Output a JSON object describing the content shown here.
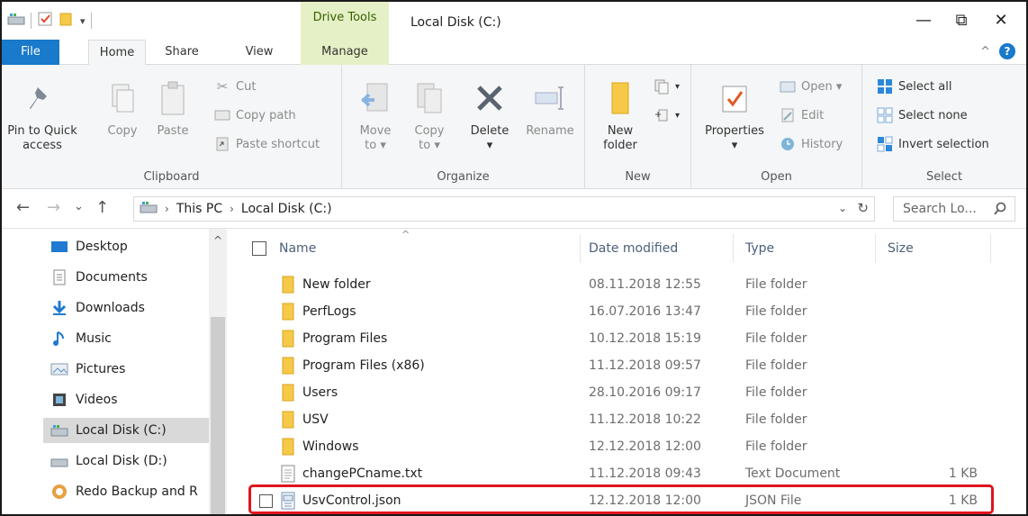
{
  "window": {
    "title": "Local Disk (C:)",
    "context_tab_header": "Drive Tools",
    "minimize": "—",
    "restore": "⧉",
    "close": "✕"
  },
  "tabs": {
    "file": "File",
    "home": "Home",
    "share": "Share",
    "view": "View",
    "manage": "Manage",
    "collapse_glyph": "^",
    "help_glyph": "?"
  },
  "ribbon": {
    "clipboard": {
      "label": "Clipboard",
      "pin_line1": "Pin to Quick",
      "pin_line2": "access",
      "copy": "Copy",
      "paste": "Paste",
      "cut": "Cut",
      "copy_path": "Copy path",
      "paste_shortcut": "Paste shortcut"
    },
    "organize": {
      "label": "Organize",
      "move_line1": "Move",
      "move_line2": "to ▾",
      "copy_line1": "Copy",
      "copy_line2": "to ▾",
      "delete_line1": "Delete",
      "delete_line2": "▾",
      "rename": "Rename"
    },
    "new": {
      "label": "New",
      "folder_line1": "New",
      "folder_line2": "folder"
    },
    "open": {
      "label": "Open",
      "properties_line1": "Properties",
      "properties_line2": "▾",
      "open": "Open ▾",
      "edit": "Edit",
      "history": "History"
    },
    "select": {
      "label": "Select",
      "select_all": "Select all",
      "select_none": "Select none",
      "invert": "Invert selection"
    }
  },
  "address": {
    "back": "←",
    "forward": "→",
    "recent": "⌄",
    "up": "↑",
    "crumb_sep": "›",
    "crumbs": [
      "This PC",
      "Local Disk (C:)"
    ],
    "dropdown": "⌄",
    "refresh": "↻",
    "search_placeholder": "Search Lo..."
  },
  "nav": {
    "scroll_up": "^",
    "items": [
      {
        "label": "Desktop",
        "icon": "desktop-icon"
      },
      {
        "label": "Documents",
        "icon": "documents-icon"
      },
      {
        "label": "Downloads",
        "icon": "downloads-icon"
      },
      {
        "label": "Music",
        "icon": "music-icon"
      },
      {
        "label": "Pictures",
        "icon": "pictures-icon"
      },
      {
        "label": "Videos",
        "icon": "videos-icon"
      },
      {
        "label": "Local Disk (C:)",
        "icon": "drive-icon",
        "selected": true
      },
      {
        "label": "Local Disk (D:)",
        "icon": "drive-icon"
      },
      {
        "label": "Redo Backup and R",
        "icon": "backup-drive-icon"
      }
    ]
  },
  "filelist": {
    "columns": {
      "name": "Name",
      "date": "Date modified",
      "type": "Type",
      "size": "Size"
    },
    "sort_caret": "^",
    "rows": [
      {
        "name": "New folder",
        "date": "08.11.2018 12:55",
        "type": "File folder",
        "size": "",
        "kind": "folder"
      },
      {
        "name": "PerfLogs",
        "date": "16.07.2016 13:47",
        "type": "File folder",
        "size": "",
        "kind": "folder"
      },
      {
        "name": "Program Files",
        "date": "10.12.2018 15:19",
        "type": "File folder",
        "size": "",
        "kind": "folder"
      },
      {
        "name": "Program Files (x86)",
        "date": "11.12.2018 09:57",
        "type": "File folder",
        "size": "",
        "kind": "folder"
      },
      {
        "name": "Users",
        "date": "28.10.2016 09:17",
        "type": "File folder",
        "size": "",
        "kind": "folder"
      },
      {
        "name": "USV",
        "date": "11.12.2018 10:22",
        "type": "File folder",
        "size": "",
        "kind": "folder"
      },
      {
        "name": "Windows",
        "date": "12.12.2018 12:00",
        "type": "File folder",
        "size": "",
        "kind": "folder"
      },
      {
        "name": "changePCname.txt",
        "date": "11.12.2018 09:43",
        "type": "Text Document",
        "size": "1 KB",
        "kind": "text"
      },
      {
        "name": "UsvControl.json",
        "date": "12.12.2018 12:00",
        "type": "JSON File",
        "size": "1 KB",
        "kind": "json",
        "highlighted": true
      }
    ]
  },
  "colors": {
    "file_tab": "#1979ca",
    "context_tab": "#e6f0c6",
    "folder": "#f7c948",
    "highlight": "#e0141e",
    "selected_nav": "#d9d9d9"
  }
}
